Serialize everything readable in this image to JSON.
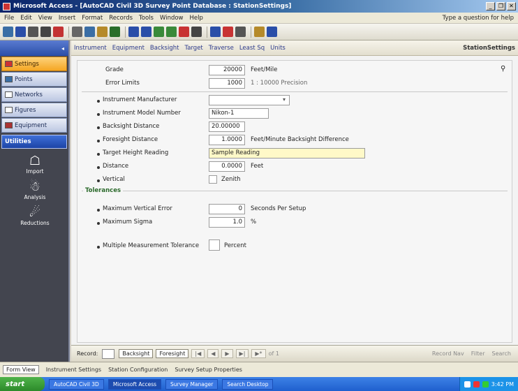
{
  "window": {
    "title": "Microsoft Access - [AutoCAD Civil 3D Survey Point Database : StationSettings]"
  },
  "menu": {
    "items": [
      "File",
      "Edit",
      "View",
      "Insert",
      "Format",
      "Records",
      "Tools",
      "Window",
      "Help"
    ],
    "help_placeholder": "Type a question for help"
  },
  "toolbar": {
    "icons": [
      {
        "name": "view-icon",
        "color": "#3a6ea5"
      },
      {
        "name": "save-icon",
        "color": "#2a4ea8"
      },
      {
        "name": "print-icon",
        "color": "#555555"
      },
      {
        "name": "preview-icon",
        "color": "#444444"
      },
      {
        "name": "spell-icon",
        "color": "#c33333"
      },
      {
        "name": "cut-icon",
        "color": "#666666"
      },
      {
        "name": "copy-icon",
        "color": "#3a6ea5"
      },
      {
        "name": "paste-icon",
        "color": "#b58a2a"
      },
      {
        "name": "undo-icon",
        "color": "#2a6e2a"
      },
      {
        "name": "sort-asc-icon",
        "color": "#2a4ea8"
      },
      {
        "name": "sort-desc-icon",
        "color": "#2a4ea8"
      },
      {
        "name": "filter-icon",
        "color": "#3a8a3a"
      },
      {
        "name": "filter-form-icon",
        "color": "#3a8a3a"
      },
      {
        "name": "apply-filter-icon",
        "color": "#c83333"
      },
      {
        "name": "find-icon",
        "color": "#444444"
      },
      {
        "name": "new-record-icon",
        "color": "#2a4ea8"
      },
      {
        "name": "delete-record-icon",
        "color": "#c83333"
      },
      {
        "name": "database-icon",
        "color": "#555555"
      },
      {
        "name": "new-object-icon",
        "color": "#b58a2a"
      },
      {
        "name": "help-icon",
        "color": "#2a4ea8"
      }
    ]
  },
  "nav": {
    "items": [
      {
        "label": "Settings",
        "active": true
      },
      {
        "label": "Points",
        "active": false
      },
      {
        "label": "Networks",
        "active": false
      },
      {
        "label": "Figures",
        "active": false
      },
      {
        "label": "Equipment",
        "active": false
      }
    ],
    "group": "Utilities",
    "launchers": [
      {
        "label": "Import",
        "icon": "☖"
      },
      {
        "label": "Analysis",
        "icon": "☃"
      },
      {
        "label": "Reductions",
        "icon": "☄"
      }
    ]
  },
  "tabs": {
    "items": [
      "Instrument",
      "Equipment",
      "Backsight",
      "Target",
      "Traverse",
      "Least Sq",
      "Units"
    ],
    "right_title": "StationSettings"
  },
  "form": {
    "top": [
      {
        "label": "Grade",
        "value": "20000",
        "unit": "Feet/Mile"
      },
      {
        "label": "Error Limits",
        "value": "1000",
        "unit": "1 : 10000 Precision"
      }
    ],
    "main": [
      {
        "label": "Instrument Manufacturer",
        "value": "",
        "has_dropdown": true,
        "unit": ""
      },
      {
        "label": "Instrument Model Number",
        "value": "Nikon-1",
        "has_dropdown": false,
        "unit": ""
      },
      {
        "label": "Backsight Distance",
        "value": "20.00000",
        "has_dropdown": false,
        "unit": ""
      },
      {
        "label": "Foresight Distance",
        "value": "1.0000",
        "has_dropdown": false,
        "unit": "Feet/Minute Backsight Difference"
      },
      {
        "label": "Target Height Reading",
        "value": "Sample Reading",
        "has_dropdown": false,
        "unit": "",
        "highlight": true
      },
      {
        "label": "Distance",
        "value": "0.0000",
        "has_dropdown": false,
        "unit": "Feet"
      },
      {
        "label": "Vertical",
        "checkbox": true,
        "unit": "Zenith"
      }
    ],
    "group_title": "Tolerances",
    "group": [
      {
        "label": "Maximum Vertical Error",
        "value": "0",
        "unit": "Seconds Per Setup"
      },
      {
        "label": "Maximum Sigma",
        "value": "1.0",
        "unit": "%"
      }
    ],
    "extra": {
      "label": "Multiple Measurement Tolerance",
      "unit": "Percent"
    }
  },
  "recnav": {
    "label": "Record:",
    "buttons": [
      "Backsight",
      "Foresight",
      "|◀",
      "◀",
      "▶",
      "▶|",
      "▶*",
      "of 1"
    ],
    "right": [
      "Record Nav",
      "Filter",
      "Search"
    ]
  },
  "status": {
    "items": [
      {
        "label": "Form View",
        "active": true
      },
      {
        "label": "Instrument Settings",
        "active": false
      },
      {
        "label": "Station Configuration",
        "active": false
      },
      {
        "label": "Survey Setup Properties",
        "active": false
      }
    ]
  },
  "taskbar": {
    "start": "start",
    "tasks": [
      {
        "label": "AutoCAD Civil 3D",
        "active": false
      },
      {
        "label": "Microsoft Access",
        "active": true
      },
      {
        "label": "Survey Manager",
        "active": false
      },
      {
        "label": "Search Desktop",
        "active": false
      }
    ],
    "clock": "3:42 PM"
  }
}
